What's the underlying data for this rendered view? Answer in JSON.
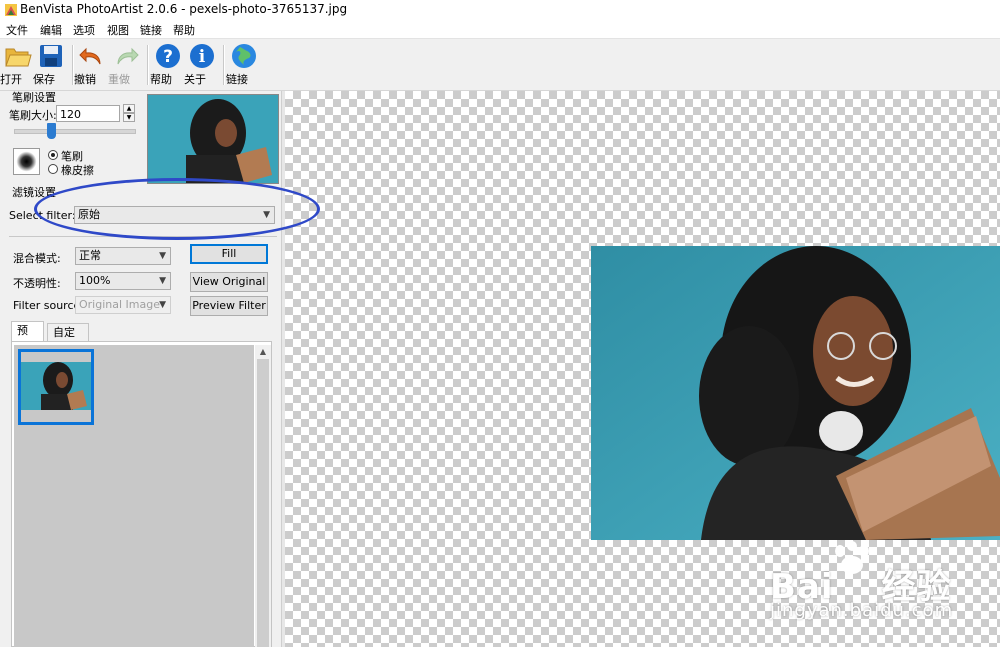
{
  "window": {
    "title": "BenVista PhotoArtist 2.0.6 - pexels-photo-3765137.jpg"
  },
  "menu": [
    "文件",
    "编辑",
    "选项",
    "视图",
    "链接",
    "帮助"
  ],
  "toolbar": {
    "open": "打开",
    "save": "保存",
    "undo": "撤销",
    "redo": "重做",
    "help": "帮助",
    "about": "关于",
    "link": "链接"
  },
  "brush_settings": {
    "title": "笔刷设置",
    "size_label": "笔刷大小:",
    "size_value": "120",
    "size_fraction": 0.3,
    "mode_brush": "笔刷",
    "mode_eraser": "橡皮擦",
    "selected_mode": "brush"
  },
  "filter_settings": {
    "title": "滤镜设置",
    "select_label": "Select filter:",
    "selected_filter": "原始",
    "blend_label": "混合模式:",
    "blend_value": "正常",
    "opacity_label": "不透明性:",
    "opacity_value": "100%",
    "source_label": "Filter source:",
    "source_value": "Original Image",
    "fill_button": "Fill",
    "view_original_button": "View Original",
    "preview_filter_button": "Preview Filter"
  },
  "tabs": {
    "preset": "预设",
    "custom": "自定义",
    "active": "preset"
  },
  "watermark": {
    "brand": "Bai",
    "brand_cn": "经验",
    "url": "jingyan.baidu.com"
  },
  "colors": {
    "accent": "#0078d7",
    "annotation": "#2f49c8",
    "selection": "#0a74d8",
    "photo_bg": "#3fa1b6"
  }
}
